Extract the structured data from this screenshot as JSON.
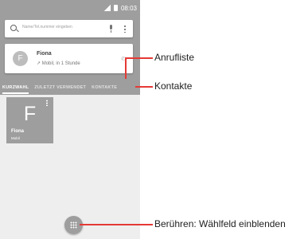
{
  "status_bar": {
    "time": "08:03"
  },
  "search": {
    "placeholder": "Name/Tel.nummer eingeben"
  },
  "recent_call": {
    "avatar_letter": "F",
    "name": "Fiona",
    "detail": "Mobil, in 1 Stunde"
  },
  "tabs": [
    {
      "label": "KURZWAHL",
      "active": true
    },
    {
      "label": "ZULETZT VERWENDET",
      "active": false
    },
    {
      "label": "KONTAKTE",
      "active": false
    }
  ],
  "favorite": {
    "letter": "F",
    "name": "Fiona",
    "type": "Mobil"
  },
  "callouts": {
    "call_log": "Anrufliste",
    "contacts": "Kontakte",
    "dialpad": "Berühren: Wählfeld einblenden"
  },
  "colors": {
    "header": "#9e9e9e",
    "background": "#eeeeee",
    "callout_line": "#e53935"
  }
}
